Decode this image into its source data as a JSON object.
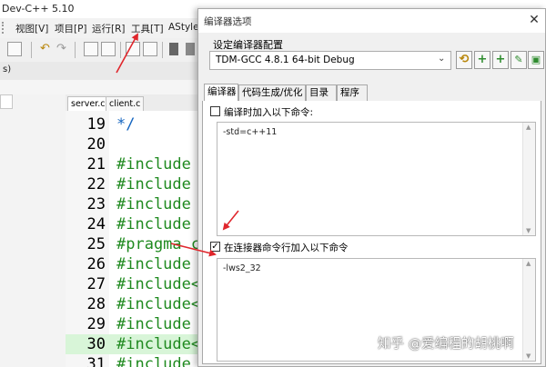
{
  "ide": {
    "title": "Dev-C++ 5.10",
    "menu": [
      "视图[V]",
      "项目[P]",
      "运行[R]",
      "工具[T]",
      "AStyle"
    ],
    "band_label": "s)",
    "file_tabs": [
      "server.c",
      "client.c"
    ],
    "lines": [
      {
        "num": "19",
        "code": "*/"
      },
      {
        "num": "20",
        "code": ""
      },
      {
        "num": "21",
        "code": "#include"
      },
      {
        "num": "22",
        "code": "#include"
      },
      {
        "num": "23",
        "code": "#include"
      },
      {
        "num": "24",
        "code": "#include"
      },
      {
        "num": "25",
        "code": "#pragma c"
      },
      {
        "num": "26",
        "code": "#include"
      },
      {
        "num": "27",
        "code": "#include<"
      },
      {
        "num": "28",
        "code": "#include<"
      },
      {
        "num": "29",
        "code": "#include"
      },
      {
        "num": "30",
        "code": "#include<"
      },
      {
        "num": "31",
        "code": "#include"
      }
    ]
  },
  "dialog": {
    "title": "编译器选项",
    "close_icon": "close-icon",
    "config_label": "设定编译器配置",
    "config_value": "TDM-GCC 4.8.1 64-bit Debug",
    "config_buttons": [
      "edit-icon",
      "add-icon",
      "add-new-icon",
      "rename-icon",
      "delete-icon"
    ],
    "tabs": [
      "编译器",
      "代码生成/优化",
      "目录",
      "程序"
    ],
    "active_tab": "编译器",
    "compile_check": {
      "label": "编译时加入以下命令:",
      "checked": false
    },
    "compile_text": "-std=c++11",
    "linker_check": {
      "label": "在连接器命令行加入以下命令",
      "checked": true
    },
    "linker_text": "-lws2_32"
  },
  "watermark": "知乎 @爱编程的胡桃啊",
  "colors": {
    "annotation_arrow": "#e0262c",
    "code_green": "#1f8a1f",
    "comment_blue": "#1565c0",
    "highlight": "#d8f5d8"
  }
}
